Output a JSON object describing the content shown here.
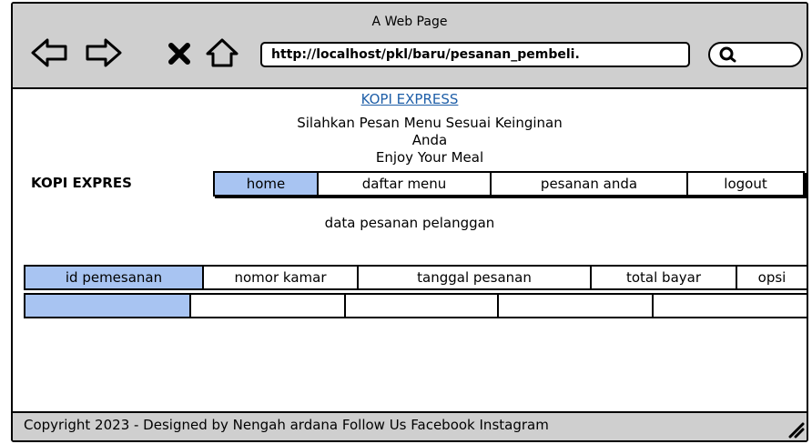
{
  "window": {
    "title": "A Web Page"
  },
  "toolbar": {
    "url": "http://localhost/pkl/baru/pesanan_pembeli.",
    "search_placeholder": ""
  },
  "header": {
    "site_title": "KOPI EXPRESS",
    "subtitle_line1": "Silahkan Pesan Menu Sesuai Keinginan",
    "subtitle_line2": "Anda",
    "subtitle_line3": "Enjoy Your Meal"
  },
  "brand": "KOPI EXPRES",
  "nav": [
    {
      "label": "home",
      "active": true
    },
    {
      "label": "daftar menu",
      "active": false
    },
    {
      "label": "pesanan anda",
      "active": false
    },
    {
      "label": "logout",
      "active": false
    }
  ],
  "main": {
    "section_title": "data pesanan pelanggan",
    "columns": [
      "id pemesanan",
      "nomor kamar",
      "tanggal pesanan",
      "total bayar",
      "opsi"
    ]
  },
  "footer": {
    "text": "Copyright  2023 - Designed by Nengah ardana    Follow Us Facebook Instagram"
  },
  "colors": {
    "accent": "#a8c4f2",
    "chrome": "#cfcfcf",
    "link": "#1f5fa8"
  }
}
